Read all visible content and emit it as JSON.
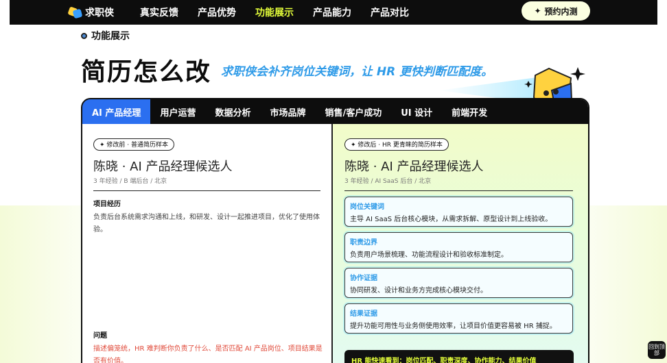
{
  "nav": {
    "logo_text": "求职侠",
    "links": [
      "真实反馈",
      "产品优势",
      "功能展示",
      "产品能力",
      "产品对比"
    ],
    "active_index": 2,
    "cta_label": "预约内测"
  },
  "section": {
    "label": "功能展示",
    "title": "简历怎么改",
    "subtitle": "求职侠会补齐岗位关键词，让 HR 更快判断匹配度。"
  },
  "tabs": [
    "AI 产品经理",
    "用户运营",
    "数据分析",
    "市场品牌",
    "销售/客户成功",
    "UI 设计",
    "前端开发"
  ],
  "active_tab": 0,
  "before": {
    "pill": "✦ 修改前 · 普通简历样本",
    "name": "陈晓 · AI 产品经理候选人",
    "meta": "3 年经验 / B 端后台 / 北京",
    "exp_head": "项目经历",
    "exp_body": "负责后台系统需求沟通和上线，和研发、设计一起推进项目，优化了使用体验。",
    "problem_head": "问题",
    "problem_body": "描述偏笼统，HR 难判断你负责了什么、是否匹配 AI 产品岗位、项目结果是否有价值。"
  },
  "after": {
    "pill": "✦ 修改后 · HR 更青睐的简历样本",
    "name": "陈晓 · AI 产品经理候选人",
    "meta": "3 年经验 / AI SaaS 后台 / 北京",
    "boxes": [
      {
        "head": "岗位关键词",
        "body": "主导 AI SaaS 后台核心模块，从需求拆解、原型设计到上线验收。"
      },
      {
        "head": "职责边界",
        "body": "负责用户场景梳理、功能流程设计和验收标准制定。"
      },
      {
        "head": "协作证据",
        "body": "协同研发、设计和业务方完成核心模块交付。"
      },
      {
        "head": "结果证据",
        "body": "提升功能可用性与业务侧使用效率，让项目价值更容易被 HR 捕捉。"
      }
    ],
    "summary": "HR 能快速看到：岗位匹配、职责深度、协作能力、结果价值"
  },
  "corner_button": "回到顶部",
  "colors": {
    "accent_blue": "#2b6ff0",
    "nav_active": "#e5ff3a",
    "keyword_blue": "#2f9be8",
    "problem_red": "#e04a3a"
  }
}
